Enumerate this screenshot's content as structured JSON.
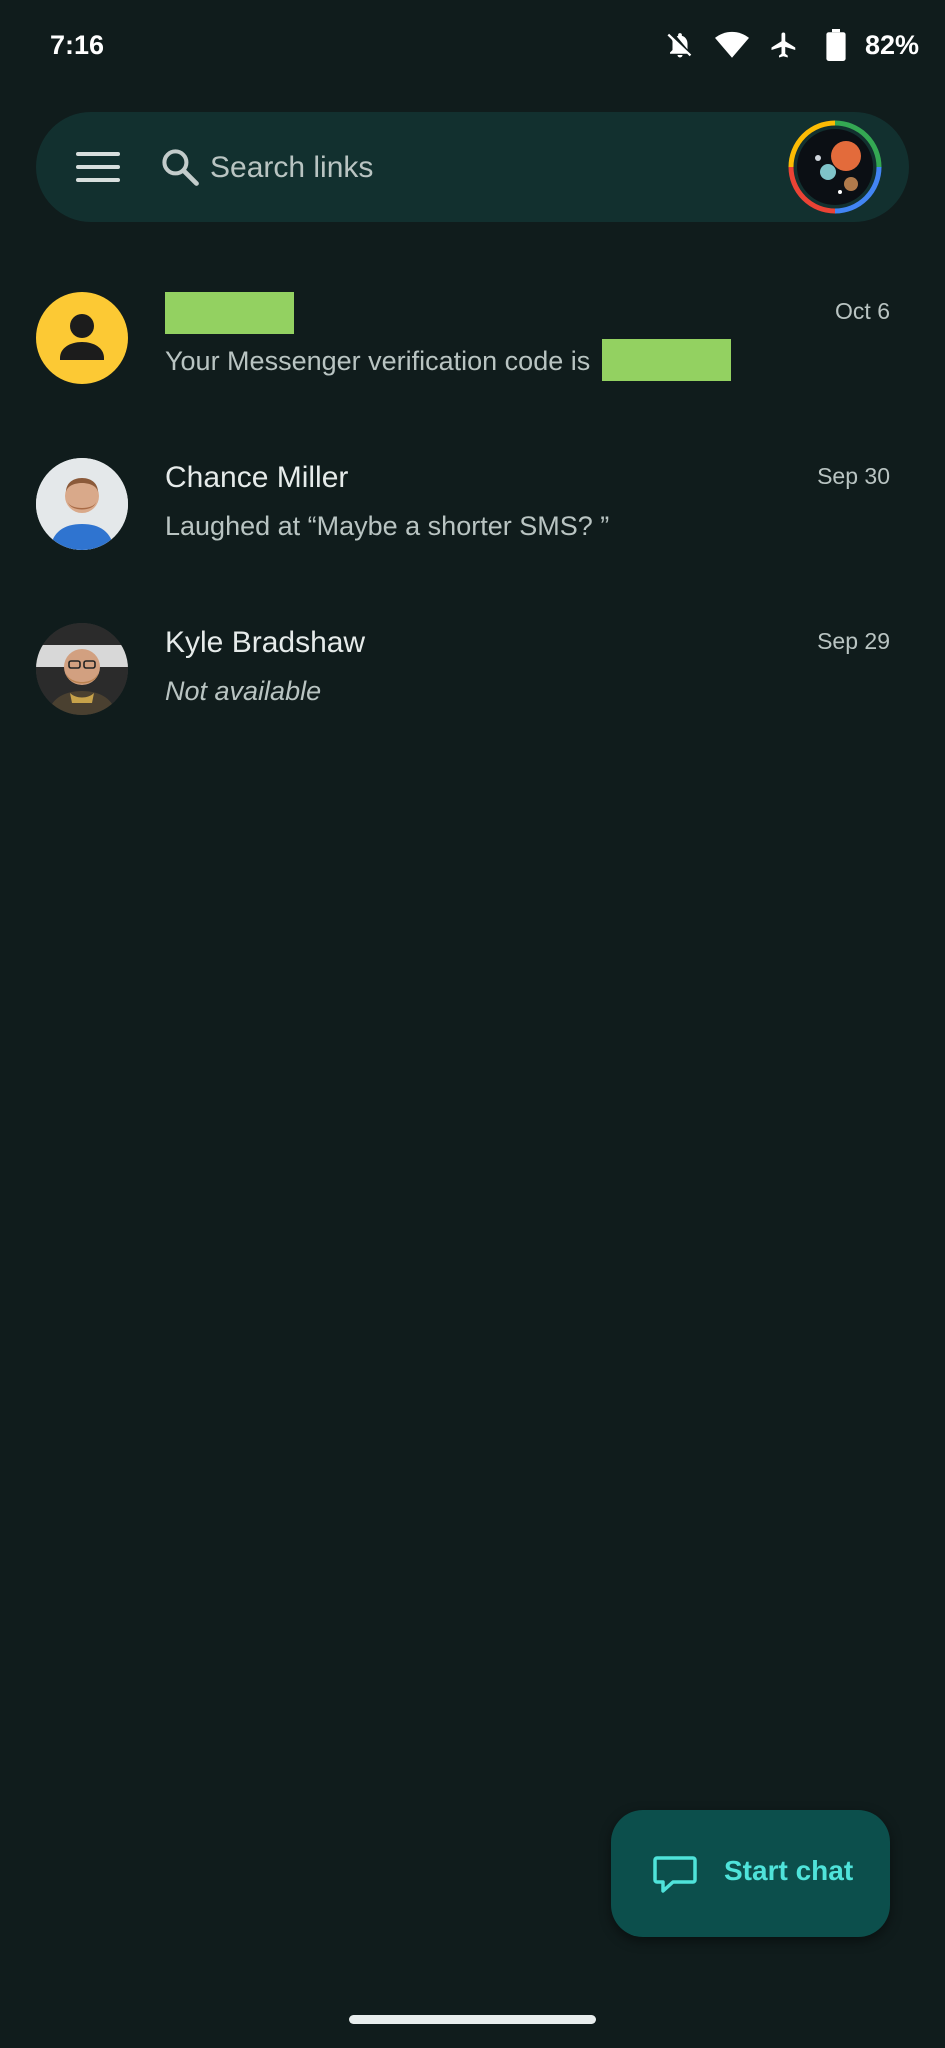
{
  "status_bar": {
    "time": "7:16",
    "battery_percent": "82%",
    "icons": [
      "bell-off-icon",
      "wifi-icon",
      "airplane-mode-icon",
      "battery-icon"
    ]
  },
  "search": {
    "placeholder": "Search links",
    "value": ""
  },
  "conversations": [
    {
      "name": "",
      "name_redacted": true,
      "snippet": "Your Messenger verification code is",
      "snippet_redacted_suffix": true,
      "date": "Oct 6",
      "avatar": "default-person-avatar"
    },
    {
      "name": "Chance Miller",
      "snippet": "Laughed at “Maybe a shorter SMS? ”",
      "date": "Sep 30",
      "avatar": "photo-avatar"
    },
    {
      "name": "Kyle Bradshaw",
      "snippet": "Not available",
      "date": "Sep 29",
      "avatar": "photo-avatar"
    }
  ],
  "fab": {
    "label": "Start chat",
    "icon": "chat-bubble-icon"
  },
  "colors": {
    "background": "#101c1c",
    "search_bar": "#12302f",
    "fab_background": "#0c4f4c",
    "fab_accent": "#4fe3da",
    "redaction": "#93d161",
    "default_avatar": "#fcc934"
  }
}
